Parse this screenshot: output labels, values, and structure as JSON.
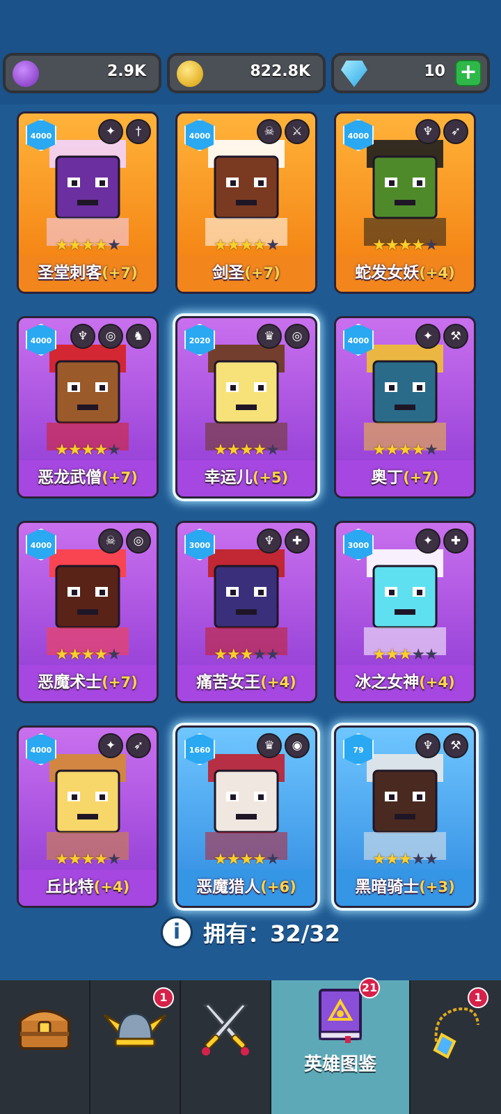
{
  "currencies": {
    "gem_purple": {
      "value": "2.9K",
      "icon": "purple-coin-icon",
      "color": "#8e44c9"
    },
    "gold": {
      "value": "822.8K",
      "icon": "gold-coin-icon",
      "color": "#f3c21a"
    },
    "diamond": {
      "value": "10",
      "icon": "diamond-icon",
      "color": "#4fd2ff",
      "add_label": "+"
    }
  },
  "heroes": [
    {
      "name": "圣堂刺客",
      "bonus": "(+7)",
      "power": "4000",
      "stars": 4,
      "rarity": "legend",
      "classes": [
        "wings-emblem-icon",
        "dagger-icon"
      ]
    },
    {
      "name": "剑圣",
      "bonus": "(+7)",
      "power": "4000",
      "stars": 4,
      "rarity": "legend",
      "classes": [
        "skull-emblem-icon",
        "sword-icon"
      ]
    },
    {
      "name": "蛇发女妖",
      "bonus": "(+4)",
      "power": "4000",
      "stars": 4,
      "rarity": "legend",
      "classes": [
        "demon-emblem-icon",
        "bow-icon"
      ]
    },
    {
      "name": "恶龙武僧",
      "bonus": "(+7)",
      "power": "4000",
      "stars": 4,
      "rarity": "epic",
      "classes": [
        "demon-emblem-icon",
        "spiral-icon",
        "dragon-icon"
      ]
    },
    {
      "name": "幸运儿",
      "bonus": "(+5)",
      "power": "2020",
      "stars": 4,
      "rarity": "epic",
      "classes": [
        "elf-emblem-icon",
        "spiral-icon"
      ]
    },
    {
      "name": "奥丁",
      "bonus": "(+7)",
      "power": "4000",
      "stars": 4,
      "rarity": "epic",
      "classes": [
        "wings-emblem-icon",
        "hammer-icon"
      ]
    },
    {
      "name": "恶魔术士",
      "bonus": "(+7)",
      "power": "4000",
      "stars": 4,
      "rarity": "epic",
      "classes": [
        "skull-emblem-icon",
        "spiral-icon"
      ]
    },
    {
      "name": "痛苦女王",
      "bonus": "(+4)",
      "power": "3000",
      "stars": 3,
      "rarity": "epic",
      "classes": [
        "demon-emblem-icon",
        "staff-icon"
      ]
    },
    {
      "name": "冰之女神",
      "bonus": "(+4)",
      "power": "3000",
      "stars": 3,
      "rarity": "epic",
      "classes": [
        "wings-emblem-icon",
        "staff-icon"
      ]
    },
    {
      "name": "丘比特",
      "bonus": "(+4)",
      "power": "4000",
      "stars": 4,
      "rarity": "epic",
      "classes": [
        "wings-emblem-icon",
        "bow-icon"
      ]
    },
    {
      "name": "恶魔猎人",
      "bonus": "(+6)",
      "power": "1660",
      "stars": 4,
      "rarity": "rare",
      "classes": [
        "elf-emblem-icon",
        "eye-icon"
      ]
    },
    {
      "name": "黑暗骑士",
      "bonus": "(+3)",
      "power": "79",
      "stars": 3,
      "rarity": "rare",
      "classes": [
        "demon-emblem-icon",
        "hammer-icon"
      ]
    }
  ],
  "owned_text": "拥有：32/32",
  "info_glyph": "i",
  "nav": [
    {
      "id": "shop",
      "icon": "treasure-chest-icon",
      "label": "",
      "badge": ""
    },
    {
      "id": "heroes",
      "icon": "viking-helmet-icon",
      "label": "",
      "badge": "1"
    },
    {
      "id": "battle",
      "icon": "crossed-swords-icon",
      "label": "",
      "badge": ""
    },
    {
      "id": "codex",
      "icon": "spellbook-icon",
      "label": "英雄图鉴",
      "badge": "21"
    },
    {
      "id": "gear",
      "icon": "amulet-icon",
      "label": "",
      "badge": "1"
    }
  ]
}
